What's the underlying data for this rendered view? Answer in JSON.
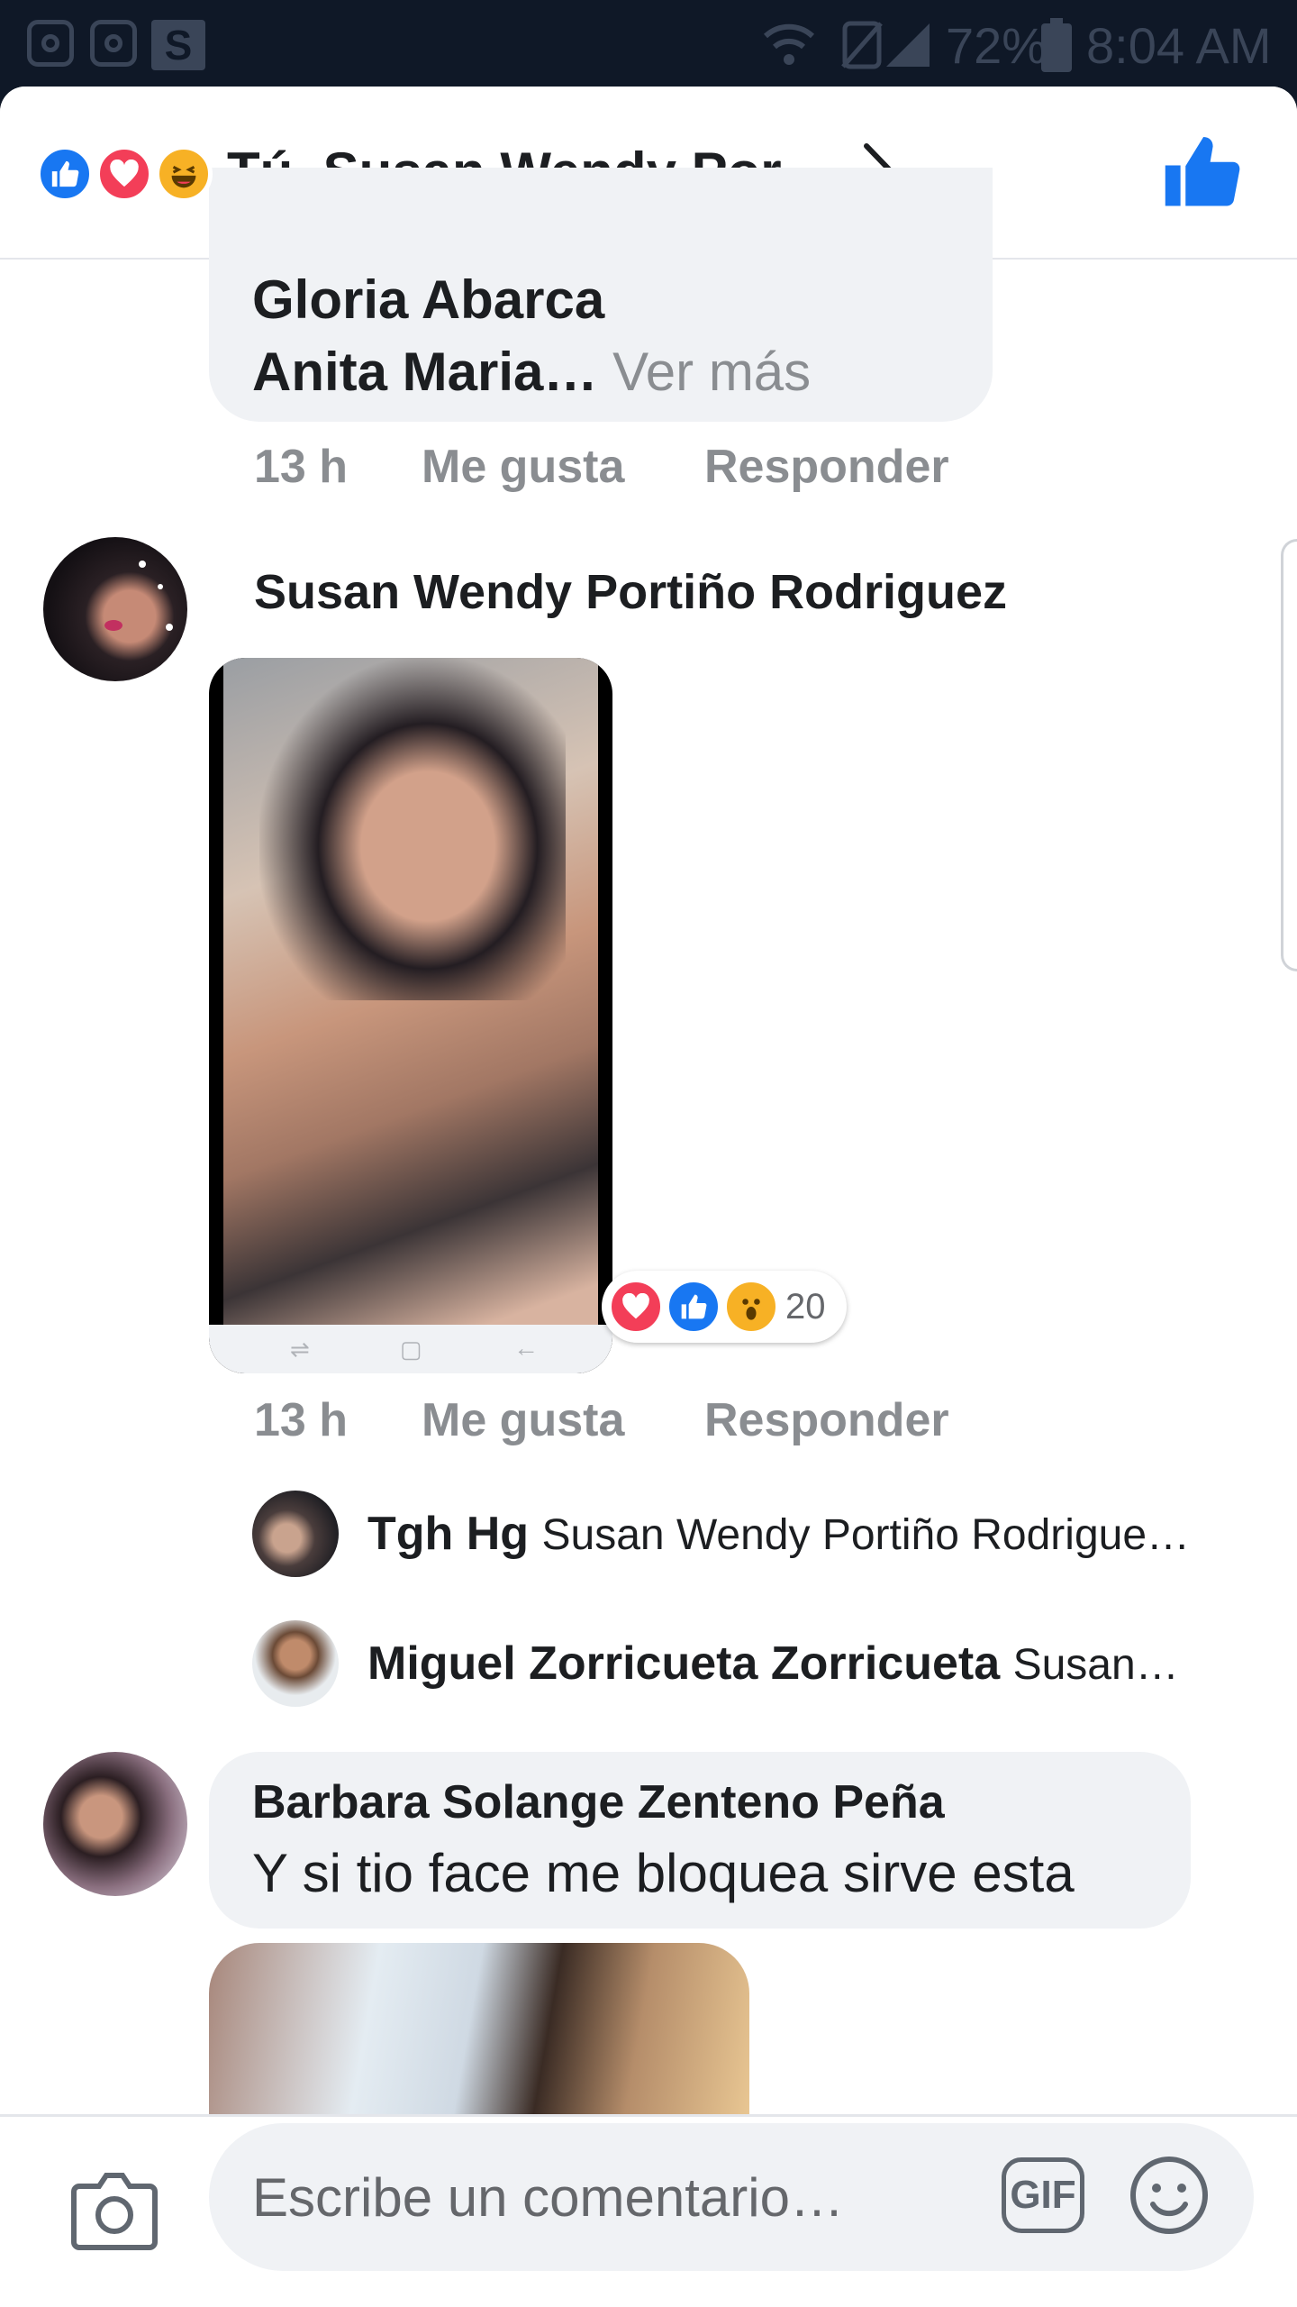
{
  "status_bar": {
    "s_icon": "S",
    "battery": "72%",
    "time": "8:04 AM"
  },
  "header": {
    "title": "Tú, Susan Wendy Por…",
    "reactions": [
      "like-reaction",
      "love-reaction",
      "haha-reaction"
    ]
  },
  "comments": [
    {
      "name": "Gloria Abarca",
      "line2": "Anita Maria…",
      "more_label": "Ver más",
      "time": "13 h",
      "like_label": "Me gusta",
      "reply_label": "Responder"
    },
    {
      "name": "Susan Wendy Portiño Rodriguez",
      "reactions": [
        "love-reaction",
        "like-reaction",
        "wow-reaction"
      ],
      "reaction_count": "20",
      "time": "13 h",
      "like_label": "Me gusta",
      "reply_label": "Responder",
      "replies": [
        {
          "name": "Tgh Hg",
          "text": "Susan Wendy Portiño Rodrigue…"
        },
        {
          "name": "Miguel Zorricueta Zorricueta",
          "text": "Susan…"
        }
      ]
    },
    {
      "name": "Barbara Solange Zenteno Peña",
      "text": "Y si tio face me bloquea sirve esta"
    }
  ],
  "composer": {
    "placeholder": "Escribe un comentario…",
    "gif_label": "GIF"
  },
  "colors": {
    "brand_blue": "#1877f2",
    "love_red": "#f33e58",
    "haha_yellow": "#f7b125",
    "meta_gray": "#8a8d91"
  }
}
